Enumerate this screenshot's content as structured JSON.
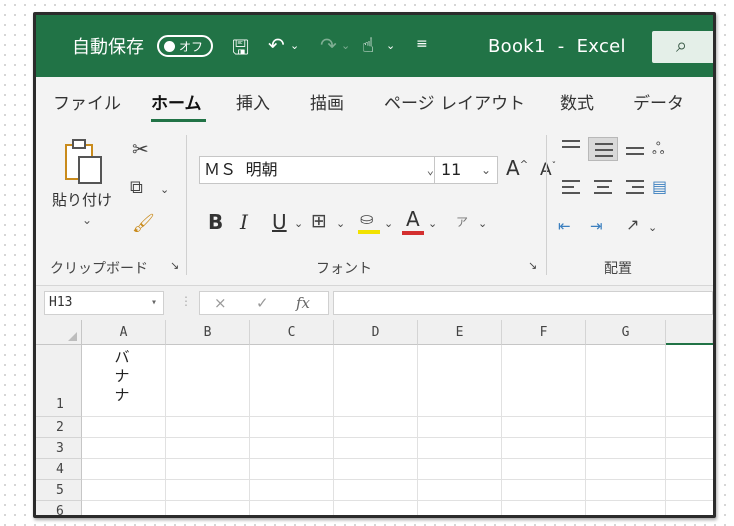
{
  "titlebar": {
    "autosave_label": "自動保存",
    "autosave_state": "オフ",
    "title": "Book1  -  Excel"
  },
  "tabs": [
    "ファイル",
    "ホーム",
    "挿入",
    "描画",
    "ページ レイアウト",
    "数式",
    "データ"
  ],
  "active_tab": "ホーム",
  "ribbon": {
    "clipboard": {
      "paste_label": "貼り付け",
      "group_label": "クリップボード"
    },
    "font": {
      "font_name": "ＭＳ 明朝",
      "font_size": "11",
      "bold": "B",
      "italic": "I",
      "underline": "U",
      "font_color": "A",
      "grow": "A",
      "shrink": "A",
      "group_label": "フォント"
    },
    "alignment": {
      "group_label": "配置"
    }
  },
  "formula_bar": {
    "name_box": "H13",
    "cancel": "×",
    "enter": "✓",
    "fx": "fx",
    "value": ""
  },
  "grid": {
    "columns": [
      "A",
      "B",
      "C",
      "D",
      "E",
      "F",
      "G"
    ],
    "rows": [
      "1",
      "2",
      "3",
      "4",
      "5",
      "6"
    ],
    "cells": {
      "A1": [
        "バ",
        "ナ",
        "ナ"
      ]
    }
  },
  "colors": {
    "brand_green": "#217346",
    "font_color_bar": "#d32f2f",
    "highlight_bar": "#f2e200"
  }
}
